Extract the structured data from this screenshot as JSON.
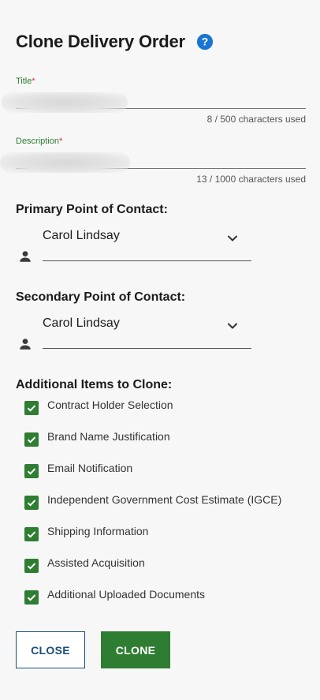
{
  "dialog": {
    "title": "Clone Delivery Order",
    "help_icon": "question-circle-icon"
  },
  "fields": {
    "title": {
      "label": "Title",
      "required_mark": "*",
      "counter": "8 / 500 characters used"
    },
    "description": {
      "label": "Description",
      "required_mark": "*",
      "counter": "13 / 1000 characters used"
    }
  },
  "primary_poc": {
    "label": "Primary Point of Contact:",
    "value": "Carol Lindsay",
    "icon": "person-icon"
  },
  "secondary_poc": {
    "label": "Secondary Point of Contact:",
    "value": "Carol Lindsay",
    "icon": "person-icon"
  },
  "clone_items": {
    "label": "Additional Items to Clone:",
    "items": [
      {
        "label": "Contract Holder Selection",
        "checked": true
      },
      {
        "label": "Brand Name Justification",
        "checked": true
      },
      {
        "label": "Email Notification",
        "checked": true
      },
      {
        "label": "Independent Government Cost Estimate (IGCE)",
        "checked": true
      },
      {
        "label": "Shipping Information",
        "checked": true
      },
      {
        "label": "Assisted Acquisition",
        "checked": true
      },
      {
        "label": "Additional Uploaded Documents",
        "checked": true
      }
    ]
  },
  "actions": {
    "close_label": "CLOSE",
    "clone_label": "CLONE"
  },
  "colors": {
    "accent_green": "#2e7d32",
    "link_blue": "#1a4f7a",
    "help_blue": "#1976d2",
    "required_red": "#d32f2f"
  }
}
